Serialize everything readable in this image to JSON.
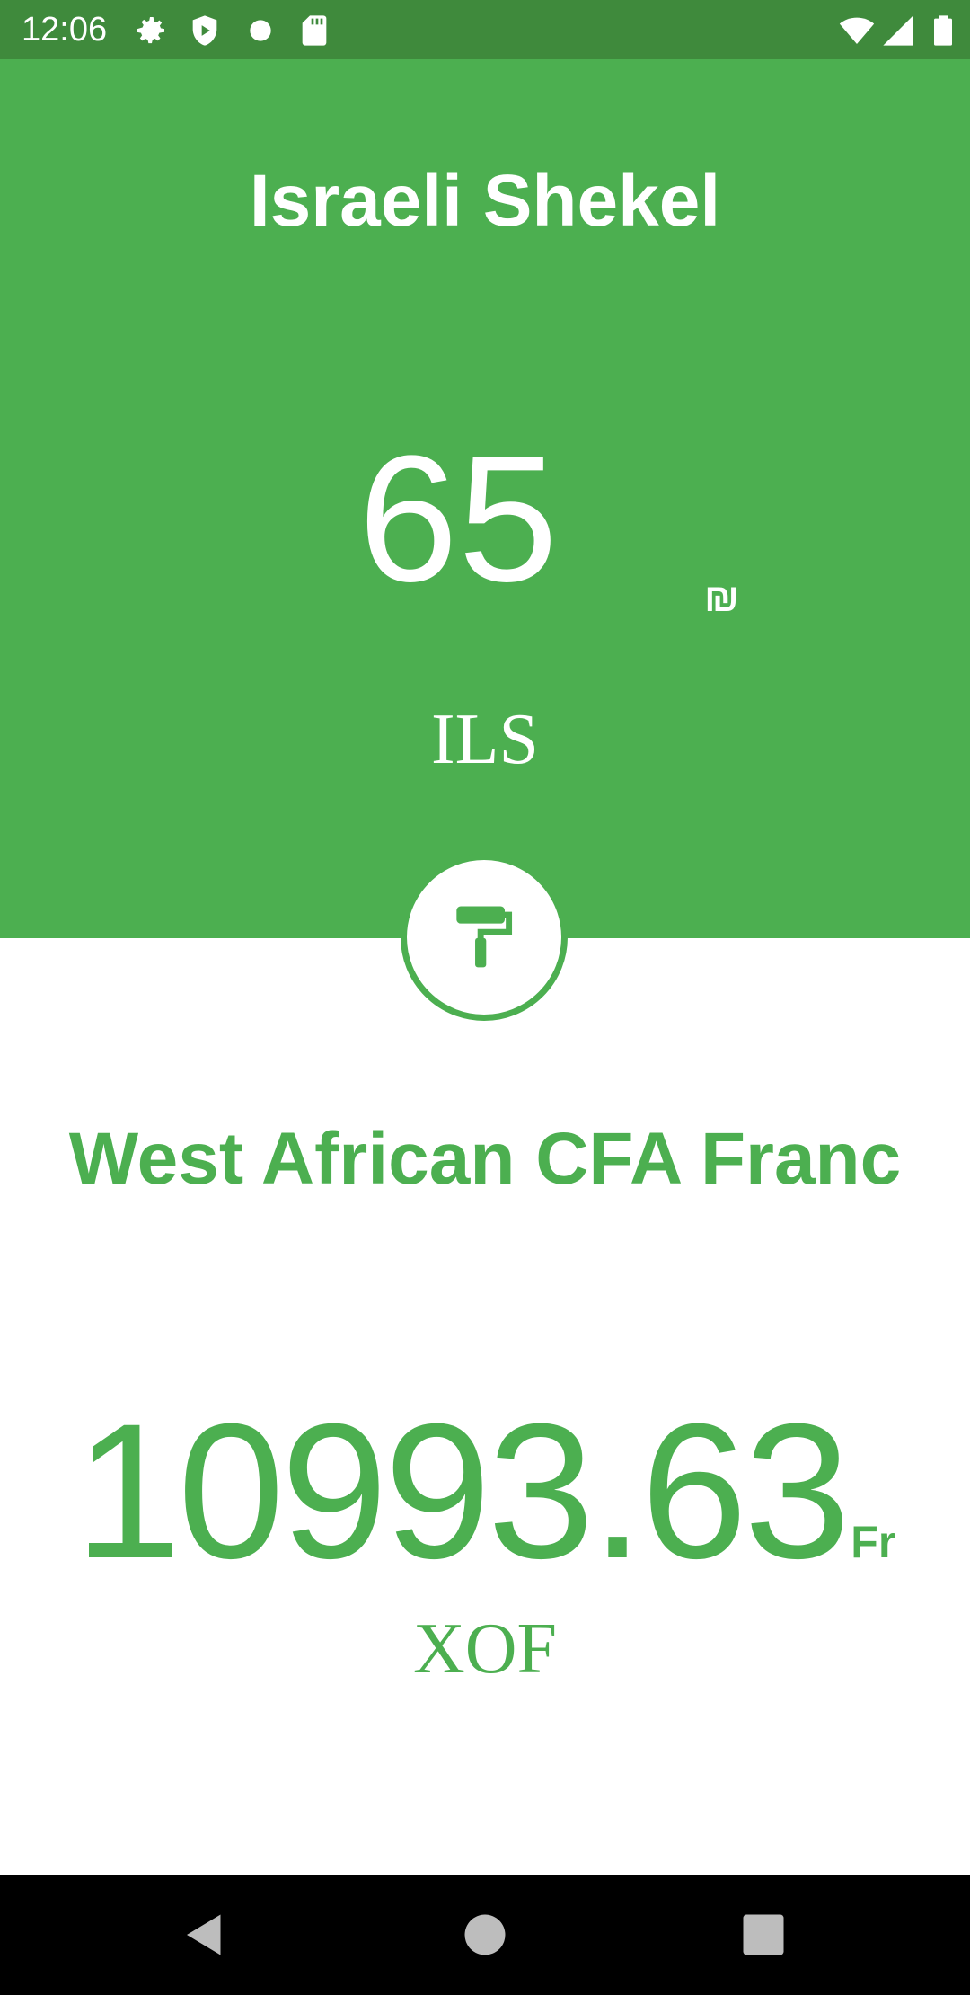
{
  "status_bar": {
    "time": "12:06",
    "icons": [
      "settings-icon",
      "shield-icon",
      "dot-icon",
      "sd-card-icon",
      "wifi-icon",
      "signal-icon",
      "battery-icon"
    ]
  },
  "from": {
    "name": "Israeli Shekel",
    "amount": "65",
    "symbol": "₪",
    "code": "ILS"
  },
  "swap_button": {
    "icon": "paint-roller-icon"
  },
  "to": {
    "name": "West African CFA Franc",
    "amount": "10993.63",
    "symbol": "Fr",
    "code": "XOF"
  },
  "nav_bar": {
    "icons": [
      "back-icon",
      "home-icon",
      "recents-icon"
    ]
  },
  "colors": {
    "primary": "#4caf50",
    "primary_dark": "#3f8a3c",
    "background": "#ffffff"
  }
}
